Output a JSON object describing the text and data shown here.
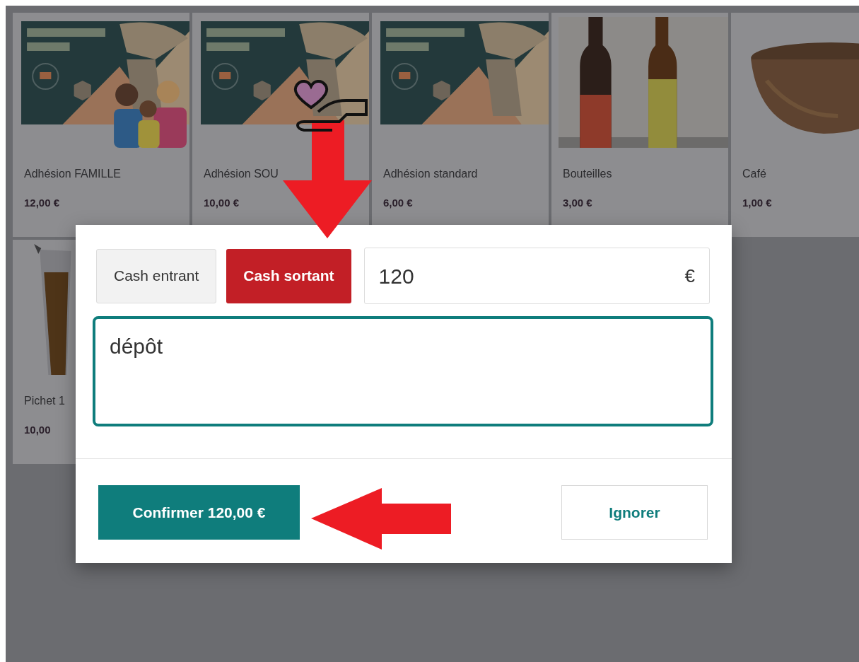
{
  "products": [
    {
      "name": "Adhésion FAMILLE",
      "price": "12,00 €",
      "kind": "poster-family"
    },
    {
      "name": "Adhésion SOU",
      "price": "10,00 €",
      "kind": "poster"
    },
    {
      "name": "Adhésion standard",
      "price": "6,00 €",
      "kind": "poster"
    },
    {
      "name": "Bouteilles",
      "price": "3,00 €",
      "kind": "bottles"
    },
    {
      "name": "Café",
      "price": "1,00 €",
      "kind": "bowl"
    },
    {
      "name": "Pichet 1",
      "price": "10,00",
      "kind": "pitcher"
    }
  ],
  "dialog": {
    "tabs": [
      {
        "label": "Cash entrant",
        "selected": false
      },
      {
        "label": "Cash sortant",
        "selected": true
      }
    ],
    "amount": {
      "value": "120",
      "currency": "€"
    },
    "note": {
      "value": "dépôt"
    },
    "confirm_button": "Confirmer 120,00 €",
    "ignore_button": "Ignorer"
  }
}
